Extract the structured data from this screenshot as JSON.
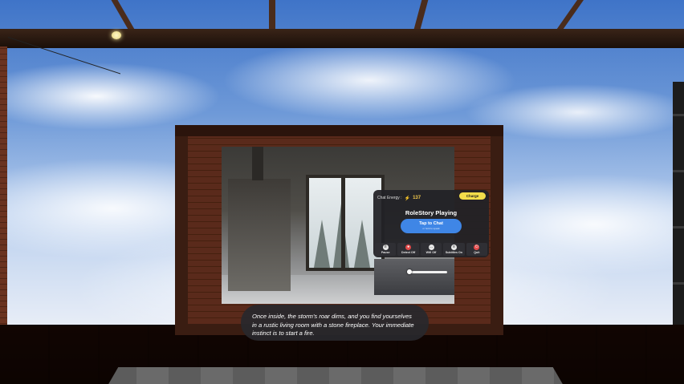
{
  "chat_panel": {
    "energy_label": "Chat Energy :",
    "energy_value": "137",
    "charge_label": "Charge",
    "status": "RoleStory Playing",
    "tap_label": "Tap to Chat",
    "tap_sublabel": "or hold to speak",
    "toolbar": [
      {
        "label": "Pause",
        "icon": "pause-icon",
        "glyph": "II"
      },
      {
        "label": "Detect Off",
        "icon": "mic-off-icon",
        "glyph": "●"
      },
      {
        "label": "Wifi Off",
        "icon": "chat-bubble-icon",
        "glyph": "…"
      },
      {
        "label": "Subtitles On",
        "icon": "subtitles-icon",
        "glyph": "≡"
      },
      {
        "label": "Quit",
        "icon": "power-icon",
        "glyph": "⏻"
      }
    ],
    "accent_color": "#3f86e6",
    "charge_color": "#f2dd4a"
  },
  "volume_slider": {
    "value": 0.0
  },
  "subtitle": {
    "text": "Once inside, the storm's roar dims, and you find yourselves in a rustic living room with a stone fireplace. Your immediate instinct is to start a fire."
  }
}
